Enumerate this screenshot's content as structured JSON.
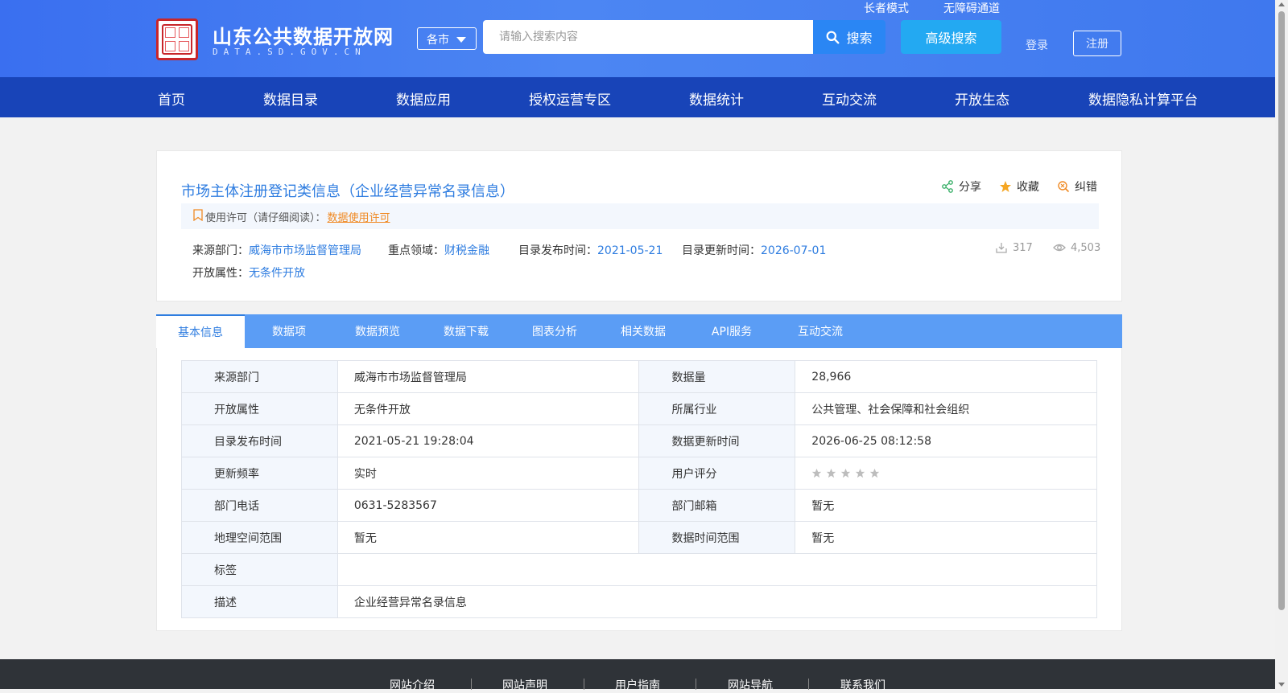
{
  "header": {
    "site_title": "山东公共数据开放网",
    "site_domain": "DATA.SD.GOV.CN",
    "city_select": "各市",
    "search_placeholder": "请输入搜索内容",
    "search_label": "搜索",
    "advanced_search_label": "高级搜索",
    "elder_mode": "长者模式",
    "accessibility": "无障碍通道",
    "login": "登录",
    "register": "注册"
  },
  "nav": {
    "items": [
      "首页",
      "数据目录",
      "数据应用",
      "授权运营专区",
      "数据统计",
      "互动交流",
      "开放生态",
      "数据隐私计算平台"
    ]
  },
  "dataset": {
    "title": "市场主体注册登记类信息（企业经营异常名录信息）",
    "actions": {
      "share": "分享",
      "favorite": "收藏",
      "report": "纠错"
    },
    "license_prefix": "使用许可（请仔细阅读）：",
    "license_link": "数据使用许可",
    "source_label": "来源部门：",
    "source_value": "威海市市场监督管理局",
    "domain_label": "重点领域：",
    "domain_value": "财税金融",
    "publish_label": "目录发布时间：",
    "publish_value": "2021-05-21",
    "update_label": "目录更新时间：",
    "update_value": "2026-07-01",
    "open_label": "开放属性：",
    "open_value": "无条件开放",
    "downloads": "317",
    "views": "4,503"
  },
  "tabs": [
    "基本信息",
    "数据项",
    "数据预览",
    "数据下载",
    "图表分析",
    "相关数据",
    "API服务",
    "互动交流"
  ],
  "info_table": {
    "rows": [
      {
        "k1": "来源部门",
        "v1": "威海市市场监督管理局",
        "k2": "数据量",
        "v2": "28,966"
      },
      {
        "k1": "开放属性",
        "v1": "无条件开放",
        "k2": "所属行业",
        "v2": "公共管理、社会保障和社会组织"
      },
      {
        "k1": "目录发布时间",
        "v1": "2021-05-21 19:28:04",
        "k2": "数据更新时间",
        "v2": "2026-06-25 08:12:58"
      },
      {
        "k1": "更新频率",
        "v1": "实时",
        "k2": "用户评分",
        "v2": ""
      },
      {
        "k1": "部门电话",
        "v1": "0631-5283567",
        "k2": "部门邮箱",
        "v2": "暂无"
      },
      {
        "k1": "地理空间范围",
        "v1": "暂无",
        "k2": "数据时间范围",
        "v2": "暂无"
      }
    ],
    "tags_label": "标签",
    "tags_value": "",
    "desc_label": "描述",
    "desc_value": "企业经营异常名录信息",
    "rating_stars": 0
  },
  "footer": {
    "links": [
      "网站介绍",
      "网站声明",
      "用户指南",
      "网站导航",
      "联系我们"
    ]
  },
  "colors": {
    "header_bg": "#3f78ee",
    "nav_bg": "#1844b8",
    "accent": "#2f7de0",
    "tab_bar": "#5b9df5",
    "license_link": "#f08a24"
  }
}
